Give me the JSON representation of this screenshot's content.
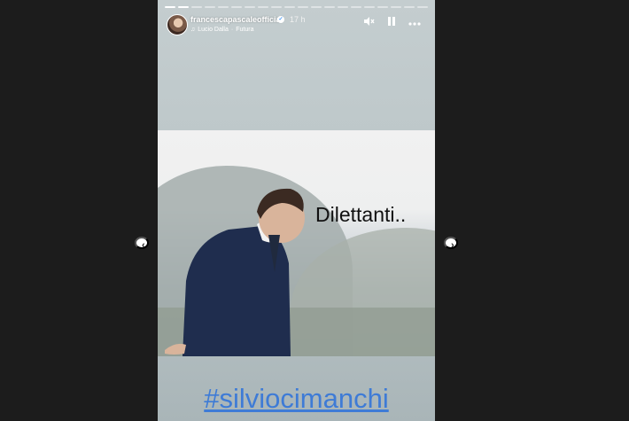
{
  "story": {
    "username": "francescapascaleofficial",
    "time": "17 h",
    "music": {
      "artist": "Lucio Dalla",
      "separator": "·",
      "song": "Futura"
    },
    "progress": {
      "segments": 20,
      "completed": 2
    },
    "controls": [
      "mute-icon",
      "pause-icon",
      "more-icon"
    ]
  },
  "photo": {
    "overlay_text": "Dilettanti.."
  },
  "caption": "#silviocimanchi",
  "nav": {
    "prev": "‹",
    "next": "›"
  },
  "colors": {
    "background": "#1c1c1c",
    "caption": "#3e7bd6"
  }
}
